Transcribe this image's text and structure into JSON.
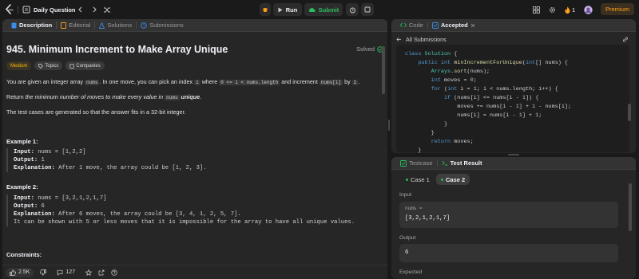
{
  "topbar": {
    "daily_label": "Daily Question",
    "run_label": "Run",
    "submit_label": "Submit",
    "streak": "1",
    "premium_label": "Premium"
  },
  "left_tabs": [
    {
      "label": "Description",
      "icon": "document-icon"
    },
    {
      "label": "Editorial",
      "icon": "book-icon"
    },
    {
      "label": "Solutions",
      "icon": "flask-icon"
    },
    {
      "label": "Submissions",
      "icon": "clock-icon"
    }
  ],
  "problem": {
    "title": "945. Minimum Increment to Make Array Unique",
    "status": "Solved",
    "difficulty": "Medium",
    "topics_label": "Topics",
    "companies_label": "Companies",
    "para1_a": "You are given an integer array ",
    "para1_code1": "nums",
    "para1_b": ". In one move, you can pick an index ",
    "para1_code2": "i",
    "para1_c": " where ",
    "para1_code3": "0 <= i < nums.length",
    "para1_d": " and increment ",
    "para1_code4": "nums[i]",
    "para1_e": " by ",
    "para1_code5": "1",
    "para1_f": ".",
    "para2_a": "Return ",
    "para2_b": "the minimum number of moves to make every value in ",
    "para2_code": "nums",
    "para2_c": " unique",
    "para2_d": ".",
    "para3": "The test cases are generated so that the answer fits in a 32-bit integer.",
    "examples": [
      {
        "title": "Example 1:",
        "input": "nums = [1,2,2]",
        "output": "1",
        "explanation": "After 1 move, the array could be [1, 2, 3].",
        "extra": ""
      },
      {
        "title": "Example 2:",
        "input": "nums = [3,2,1,2,1,7]",
        "output": "6",
        "explanation": "After 6 moves, the array could be [3, 4, 1, 2, 5, 7].",
        "extra": "It can be shown with 5 or less moves that it is impossible for the array to have all unique values."
      }
    ],
    "labels": {
      "input": "Input:",
      "output": "Output:",
      "explanation": "Explanation:"
    },
    "constraints_title": "Constraints:"
  },
  "footer": {
    "likes": "2.5K",
    "comments": "127"
  },
  "code_panel": {
    "tab_code": "Code",
    "tab_accepted": "Accepted",
    "back_label": "All Submissions",
    "lines": [
      "class Solution {",
      "    public int minIncrementForUnique(int[] nums) {",
      "        Arrays.sort(nums);",
      "        int moves = 0;",
      "        for (int i = 1; i < nums.length; i++) {",
      "            if (nums[i] <= nums[i - 1]) {",
      "                moves += nums[i - 1] + 1 - nums[i];",
      "                nums[i] = nums[i - 1] + 1;",
      "            }",
      "        }",
      "        return moves;",
      "    }",
      "}"
    ]
  },
  "test_panel": {
    "tab_testcase": "Testcase",
    "tab_result": "Test Result",
    "case1": "Case 1",
    "case2": "Case 2",
    "input_label": "Input",
    "input_var": "nums =",
    "input_value": "[3,2,1,2,1,7]",
    "output_label": "Output",
    "output_value": "6",
    "expected_label": "Expected"
  },
  "colors": {
    "accent_green": "#2cbb5d",
    "medium": "#ffb800",
    "streak": "#ffa116"
  }
}
